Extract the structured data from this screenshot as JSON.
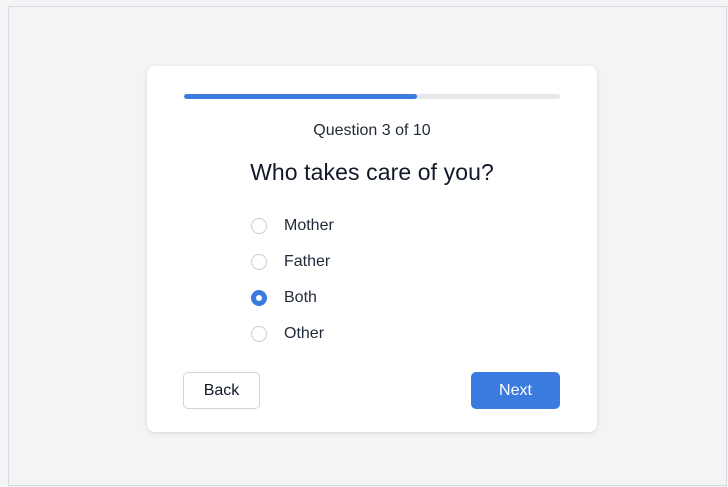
{
  "quiz": {
    "progress": {
      "current": 3,
      "total": 10,
      "fraction": 0.62
    },
    "question_counter": "Question 3 of 10",
    "question_title": "Who takes care of you?",
    "options": [
      {
        "label": "Mother",
        "selected": false
      },
      {
        "label": "Father",
        "selected": false
      },
      {
        "label": "Both",
        "selected": true
      },
      {
        "label": "Other",
        "selected": false
      }
    ],
    "buttons": {
      "back_label": "Back",
      "next_label": "Next"
    }
  },
  "colors": {
    "accent": "#3b7be0",
    "track": "#e5e7eb",
    "background": "#f3f4f6",
    "card": "#ffffff"
  }
}
